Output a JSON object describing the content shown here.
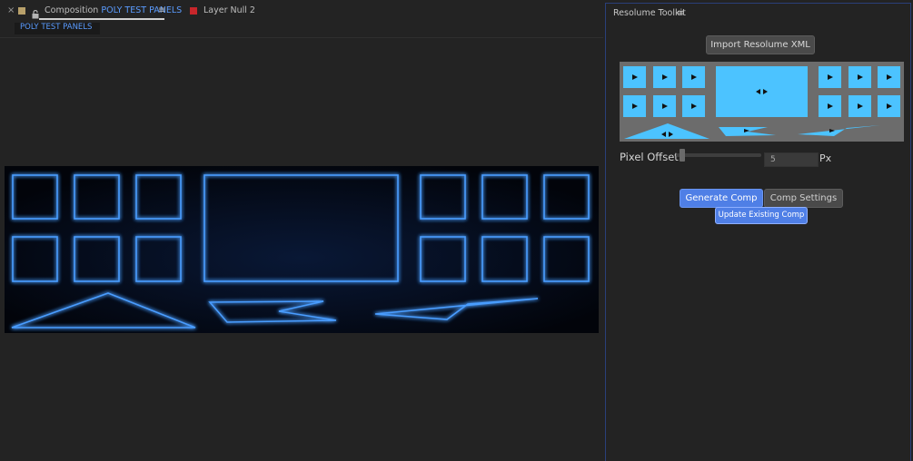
{
  "comp_tabbar": {
    "close_glyph": "×",
    "tab_prefix": "Composition",
    "tab_name": "POLY TEST PANELS",
    "menu_glyph": "≡",
    "layer_tab": "Layer Null 2",
    "accent_color": "#5b9cff",
    "layer_color": "#c7262b"
  },
  "breadcrumb": {
    "label": "POLY TEST PANELS"
  },
  "toolkit": {
    "title": "Resolume Toolkit",
    "menu_glyph": "≡",
    "import_label": "Import Resolume XML",
    "pixel_offset_label": "Pixel Offset",
    "offset_value": "5",
    "unit_label": "Px",
    "slider_value_fraction": 0.05,
    "generate_label": "Generate Comp",
    "settings_label": "Comp Settings",
    "update_label": "Update Existing Comp",
    "preview_fill_color": "#4cc3ff",
    "primary_button_color": "#4f7fe6"
  }
}
